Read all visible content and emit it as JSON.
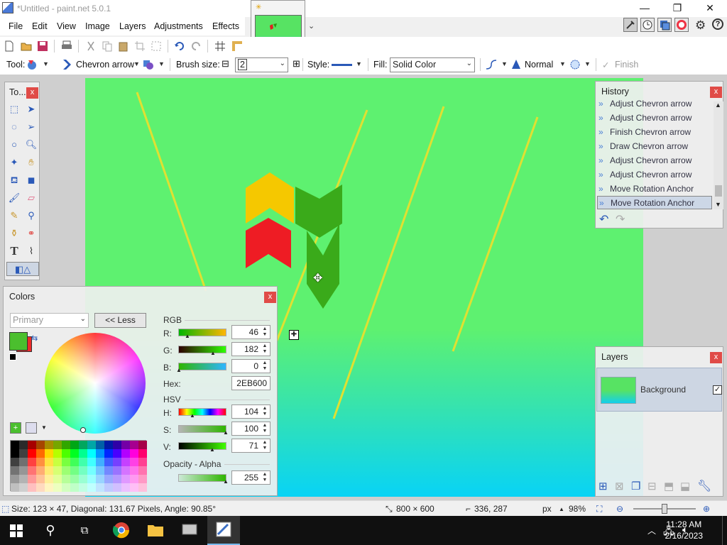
{
  "window": {
    "title": "*Untitled - paint.net 5.0.1",
    "minimize": "—",
    "maximize": "❐",
    "close": "✕"
  },
  "menu": [
    "File",
    "Edit",
    "View",
    "Image",
    "Layers",
    "Adjustments",
    "Effects"
  ],
  "toolbar": {
    "tool_label": "Tool:",
    "shape_name": "Chevron arrow",
    "brush_size_label": "Brush size:",
    "brush_size_value": "2",
    "style_label": "Style:",
    "fill_label": "Fill:",
    "fill_value": "Solid Color",
    "blend_mode": "Normal",
    "finish_label": "Finish",
    "minus": "⊟",
    "plus": "⊞"
  },
  "tools_panel": {
    "title": "To...",
    "close": "x"
  },
  "history": {
    "title": "History",
    "close": "x",
    "items": [
      "Adjust Chevron arrow",
      "Adjust Chevron arrow",
      "Finish Chevron arrow",
      "Draw Chevron arrow",
      "Adjust Chevron arrow",
      "Adjust Chevron arrow",
      "Move Rotation Anchor",
      "Move Rotation Anchor"
    ],
    "undo_icon": "↶",
    "redo_icon": "↷"
  },
  "layers": {
    "title": "Layers",
    "close": "x",
    "items": [
      {
        "name": "Background",
        "visible": true
      }
    ],
    "check": "✓"
  },
  "colors": {
    "title": "Colors",
    "close": "x",
    "mode": "Primary",
    "less_button": "<< Less",
    "rgb_label": "RGB",
    "r_label": "R:",
    "r_value": "46",
    "g_label": "G:",
    "g_value": "182",
    "b_label": "B:",
    "b_value": "0",
    "hex_label": "Hex:",
    "hex_value": "2EB600",
    "hsv_label": "HSV",
    "h_label": "H:",
    "h_value": "104",
    "s_label": "S:",
    "s_value": "100",
    "v_label": "V:",
    "v_value": "71",
    "alpha_label": "Opacity - Alpha",
    "alpha_value": "255",
    "primary_color": "#4bbf2e",
    "secondary_color": "#ee2a2a",
    "palette": [
      "#000000",
      "#404040",
      "#ff0000",
      "#ff6a00",
      "#ffd800",
      "#b6ff00",
      "#4cff00",
      "#00ff21",
      "#00ff90",
      "#00ffff",
      "#0094ff",
      "#0026ff",
      "#4800ff",
      "#b200ff",
      "#ff00dc",
      "#ff006e"
    ]
  },
  "status": {
    "selection_info": "Size: 123 × 47, Diagonal: 131.67 Pixels, Angle: 90.85°",
    "image_size": "800 × 600",
    "cursor_pos": "336, 287",
    "unit": "px",
    "zoom": "98%"
  },
  "taskbar": {
    "time": "11:28 AM",
    "date": "2/16/2023"
  }
}
